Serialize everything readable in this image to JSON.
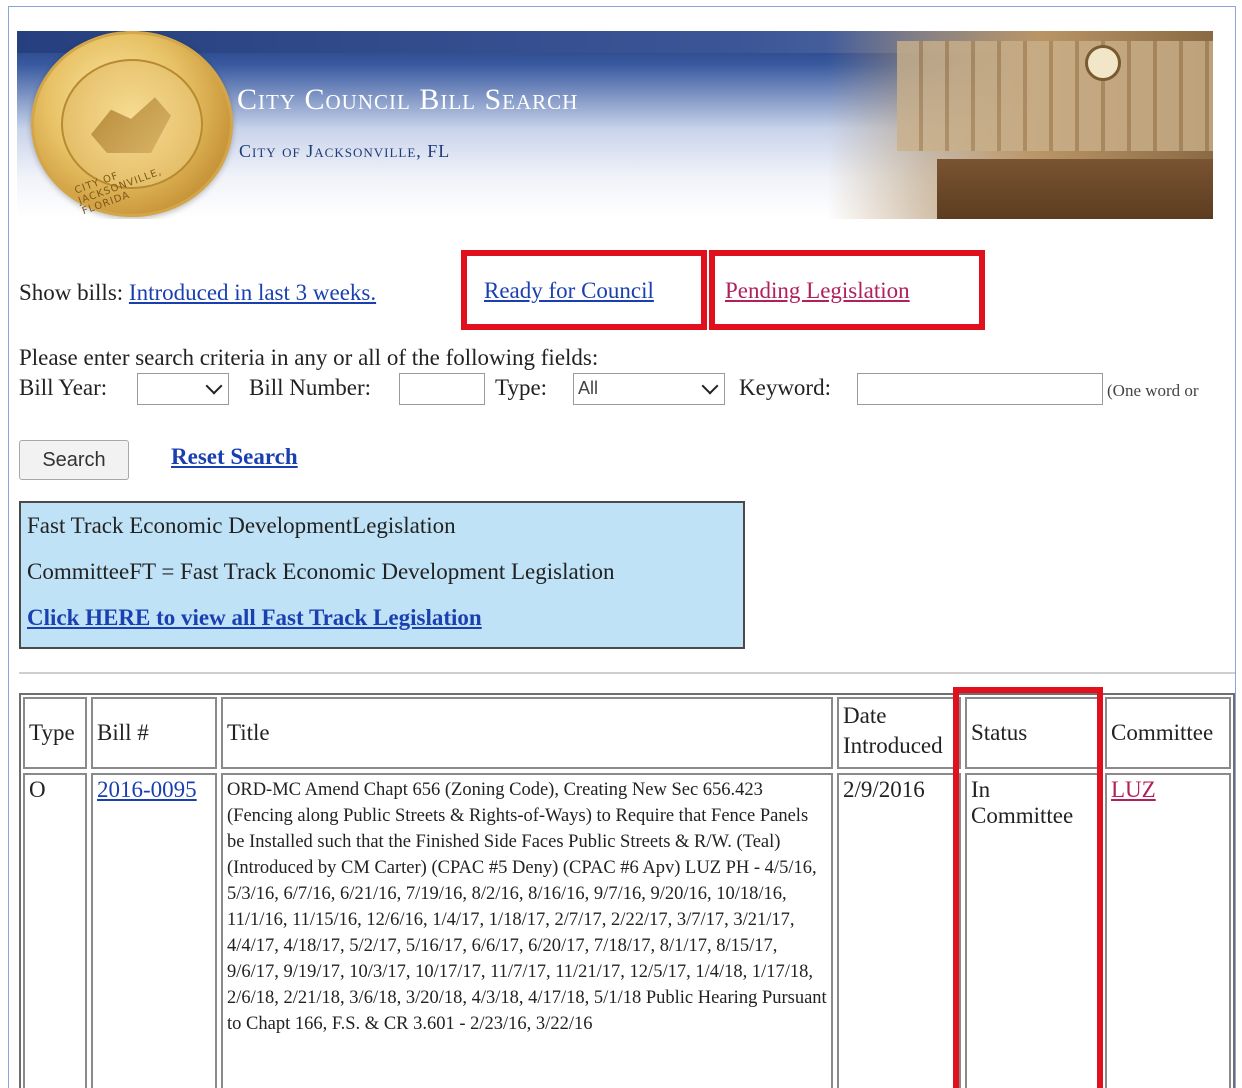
{
  "banner": {
    "title": "City Council Bill Search",
    "subtitle": "City of Jacksonville, FL",
    "seal_text": "CITY OF JACKSONVILLE, FLORIDA"
  },
  "nav": {
    "prefix": "Show bills:",
    "introduced_label": "Introduced in last 3 weeks.",
    "ready_label": "Ready for Council",
    "pending_label": "Pending Legislation"
  },
  "search": {
    "instruction": "Please enter search criteria in any or all of the following fields:",
    "bill_year_label": "Bill Year:",
    "bill_year_value": "",
    "bill_number_label": "Bill Number:",
    "bill_number_value": "",
    "type_label": "Type:",
    "type_value": "All",
    "keyword_label": "Keyword:",
    "keyword_value": "",
    "keyword_hint": "(One word or",
    "search_button": "Search",
    "reset_label": "Reset Search"
  },
  "fast_track": {
    "heading": "Fast Track Economic DevelopmentLegislation",
    "definition": "CommitteeFT = Fast Track Economic Development Legislation",
    "link_label": "Click HERE to view all Fast Track Legislation"
  },
  "table": {
    "headers": {
      "type": "Type",
      "bill": "Bill #",
      "title": "Title",
      "date_line1": "Date",
      "date_line2": "Introduced",
      "status": "Status",
      "committee": "Committee"
    },
    "rows": [
      {
        "type": "O",
        "bill": "2016-0095",
        "title": "ORD-MC Amend Chapt 656 (Zoning Code), Creating New Sec 656.423 (Fencing along Public Streets & Rights-of-Ways) to Require that Fence Panels be Installed such that the Finished Side Faces Public Streets & R/W. (Teal) (Introduced by CM Carter) (CPAC #5 Deny) (CPAC #6 Apv) LUZ PH - 4/5/16, 5/3/16, 6/7/16, 6/21/16, 7/19/16, 8/2/16, 8/16/16, 9/7/16, 9/20/16, 10/18/16, 11/1/16, 11/15/16, 12/6/16, 1/4/17, 1/18/17, 2/7/17, 2/22/17, 3/7/17, 3/21/17, 4/4/17, 4/18/17, 5/2/17, 5/16/17, 6/6/17, 6/20/17, 7/18/17, 8/1/17, 8/15/17, 9/6/17, 9/19/17, 10/3/17, 10/17/17, 11/7/17, 11/21/17, 12/5/17, 1/4/18, 1/17/18, 2/6/18, 2/21/18, 3/6/18, 3/20/18, 4/3/18, 4/17/18, 5/1/18 Public Hearing Pursuant to Chapt 166, F.S. & CR 3.601 - 2/23/16, 3/22/16",
        "date_introduced": "2/9/2016",
        "status_line1": "In",
        "status_line2": "Committee",
        "committee": "LUZ"
      }
    ]
  },
  "colors": {
    "highlight": "#e0101c",
    "link": "#1a3fb0",
    "visited_link": "#b0205a",
    "fast_track_bg": "#bfe2f7"
  }
}
